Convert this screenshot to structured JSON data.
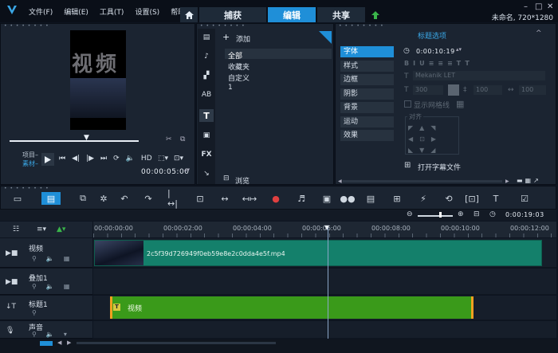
{
  "menu": [
    "文件(F)",
    "编辑(E)",
    "工具(T)",
    "设置(S)",
    "帮助"
  ],
  "tabs": [
    "捕获",
    "编辑",
    "共享"
  ],
  "project_title": "未命名, 720*1280",
  "preview": {
    "overlay_text": "视频",
    "mode_project": "项目–",
    "mode_clip": "素材–",
    "timecode": "00:00:05:00"
  },
  "library": {
    "add_label": "添加",
    "items": [
      "全部",
      "收藏夹",
      "自定义",
      "1"
    ],
    "browse_label": "浏览"
  },
  "options": {
    "header": "标题选项",
    "timecode": "0:00:10:19",
    "tabs": [
      "字体",
      "样式",
      "边框",
      "阴影",
      "背景",
      "运动",
      "效果"
    ],
    "font_name": "Mekanik LET",
    "font_size": "300",
    "line_spacing": "100",
    "letter_spacing": "100",
    "grid_label": "显示网格线",
    "align_label": "对齐",
    "open_subtitle": "打开字幕文件"
  },
  "timeline": {
    "timecode": "0:00:19:03",
    "ruler": [
      "00:00:00:00",
      "00:00:02:00",
      "00:00:04:00",
      "00:00:06:00",
      "00:00:08:00",
      "00:00:10:00",
      "00:00:12:00"
    ],
    "tracks": [
      "视频",
      "叠加1",
      "标题1",
      "声音"
    ],
    "video_clip": "2c5f39d726949f0eb59e8e2c0dda4e5f.mp4",
    "title_clip": "视频"
  },
  "colors": {
    "accent": "#1f8fd8",
    "video_clip": "#14806b",
    "title_clip": "#3a9a1a",
    "playhead": "#8aa6c8"
  }
}
